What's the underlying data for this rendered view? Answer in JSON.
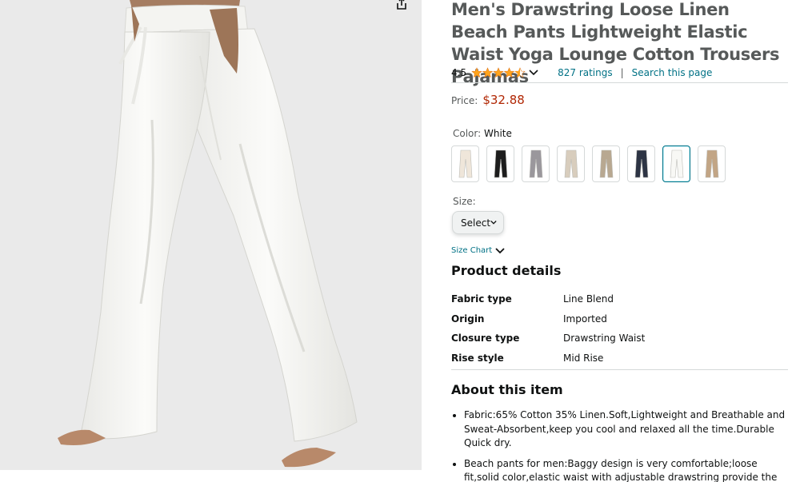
{
  "product": {
    "title": "Men's Drawstring Loose Linen Beach Pants Lightweight Elastic Waist Yoga Lounge Cotton Trousers Pajamas",
    "rating_value": "4.5",
    "stars_icon": "star-rating-4.5-icon",
    "ratings_count": "827 ratings",
    "separator": "|",
    "search_link": "Search this page",
    "price_label": "Price:",
    "price": "$32.88",
    "star_color": "#ffa41c",
    "price_color": "#b12704",
    "link_color": "#007185"
  },
  "color": {
    "label": "Color:",
    "selected": "White",
    "swatches": [
      {
        "name": "cream",
        "fill": "#efe6da"
      },
      {
        "name": "black",
        "fill": "#1d1d1d"
      },
      {
        "name": "grey",
        "fill": "#9a979c"
      },
      {
        "name": "khaki-light",
        "fill": "#d8cdbd"
      },
      {
        "name": "khaki",
        "fill": "#b8a891"
      },
      {
        "name": "navy",
        "fill": "#2d3444"
      },
      {
        "name": "white",
        "fill": "#f8f8f5"
      },
      {
        "name": "tan",
        "fill": "#c2a585"
      }
    ],
    "selected_index": 6
  },
  "size": {
    "label": "Size:",
    "select_value": "Select",
    "size_chart_link": "Size Chart"
  },
  "details": {
    "heading": "Product details",
    "rows": [
      {
        "key": "Fabric type",
        "value": "Line Blend"
      },
      {
        "key": "Origin",
        "value": "Imported"
      },
      {
        "key": "Closure type",
        "value": "Drawstring Waist"
      },
      {
        "key": "Rise style",
        "value": "Mid Rise"
      }
    ]
  },
  "about": {
    "heading": "About this item",
    "bullets": [
      "Fabric:65% Cotton 35% Linen.Soft,Lightweight and Breathable and Sweat-Absorbent,keep you cool and relaxed all the time.Durable Quick dry.",
      "Beach pants for men:Baggy design is very comfortable;loose fit,solid color,elastic waist with adjustable drawstring provide the maximum"
    ]
  },
  "icons": {
    "share": "share-icon",
    "chevron": "chevron-down-icon"
  }
}
